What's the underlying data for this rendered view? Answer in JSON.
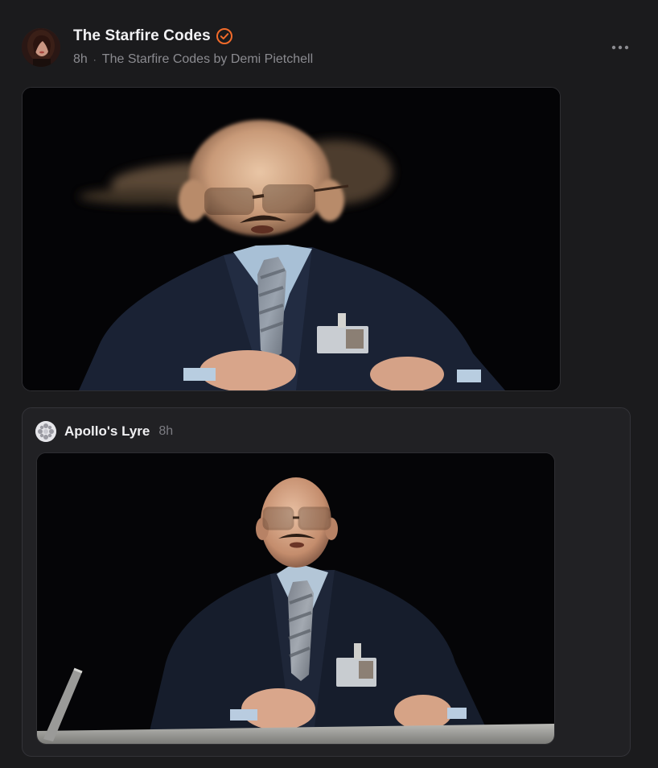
{
  "post": {
    "author_name": "The Starfire Codes",
    "verified_icon": "verified-check-icon",
    "time": "8h",
    "separator": "·",
    "publication": "The Starfire Codes by Demi Pietchell",
    "more_icon": "more-horizontal-icon"
  },
  "quoted_post": {
    "author_name": "Apollo's Lyre",
    "time": "8h"
  },
  "colors": {
    "background": "#1b1b1d",
    "card_background": "#212124",
    "accent_verified": "#f26b2a",
    "muted_text": "#8b8b90"
  }
}
